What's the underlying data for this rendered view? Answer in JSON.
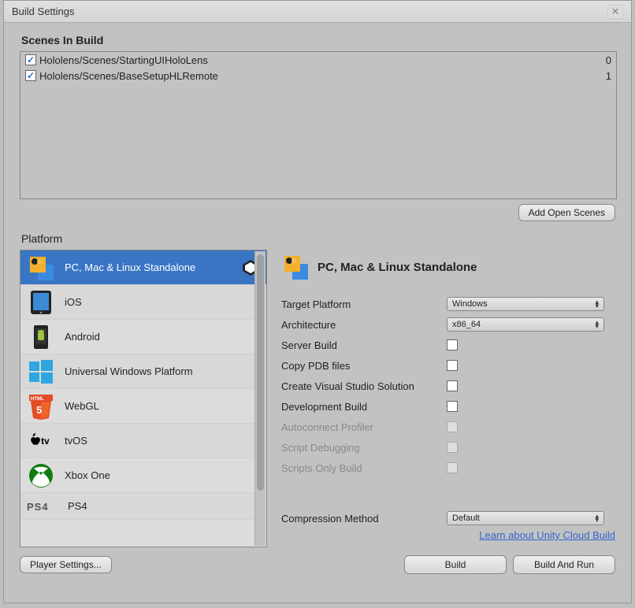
{
  "title": "Build Settings",
  "scenes_label": "Scenes In Build",
  "scenes": [
    {
      "path": "Hololens/Scenes/StartingUIHoloLens",
      "index": "0",
      "checked": true
    },
    {
      "path": "Hololens/Scenes/BaseSetupHLRemote",
      "index": "1",
      "checked": true
    }
  ],
  "add_open_scenes": "Add Open Scenes",
  "platform_label": "Platform",
  "platforms": [
    {
      "label": "PC, Mac & Linux Standalone",
      "icon": "standalone"
    },
    {
      "label": "iOS",
      "icon": "ios"
    },
    {
      "label": "Android",
      "icon": "android"
    },
    {
      "label": "Universal Windows Platform",
      "icon": "uwp"
    },
    {
      "label": "WebGL",
      "icon": "webgl"
    },
    {
      "label": "tvOS",
      "icon": "tvos"
    },
    {
      "label": "Xbox One",
      "icon": "xbox"
    },
    {
      "label": "PS4",
      "icon": "ps4"
    }
  ],
  "selected_platform_heading": "PC, Mac & Linux Standalone",
  "settings": {
    "target_platform_label": "Target Platform",
    "target_platform_value": "Windows",
    "architecture_label": "Architecture",
    "architecture_value": "x86_64",
    "server_build": "Server Build",
    "copy_pdb": "Copy PDB files",
    "create_vs": "Create Visual Studio Solution",
    "dev_build": "Development Build",
    "autoconnect": "Autoconnect Profiler",
    "script_debug": "Script Debugging",
    "scripts_only": "Scripts Only Build",
    "compression_label": "Compression Method",
    "compression_value": "Default"
  },
  "learn_link": "Learn about Unity Cloud Build",
  "player_settings": "Player Settings...",
  "build": "Build",
  "build_and_run": "Build And Run"
}
